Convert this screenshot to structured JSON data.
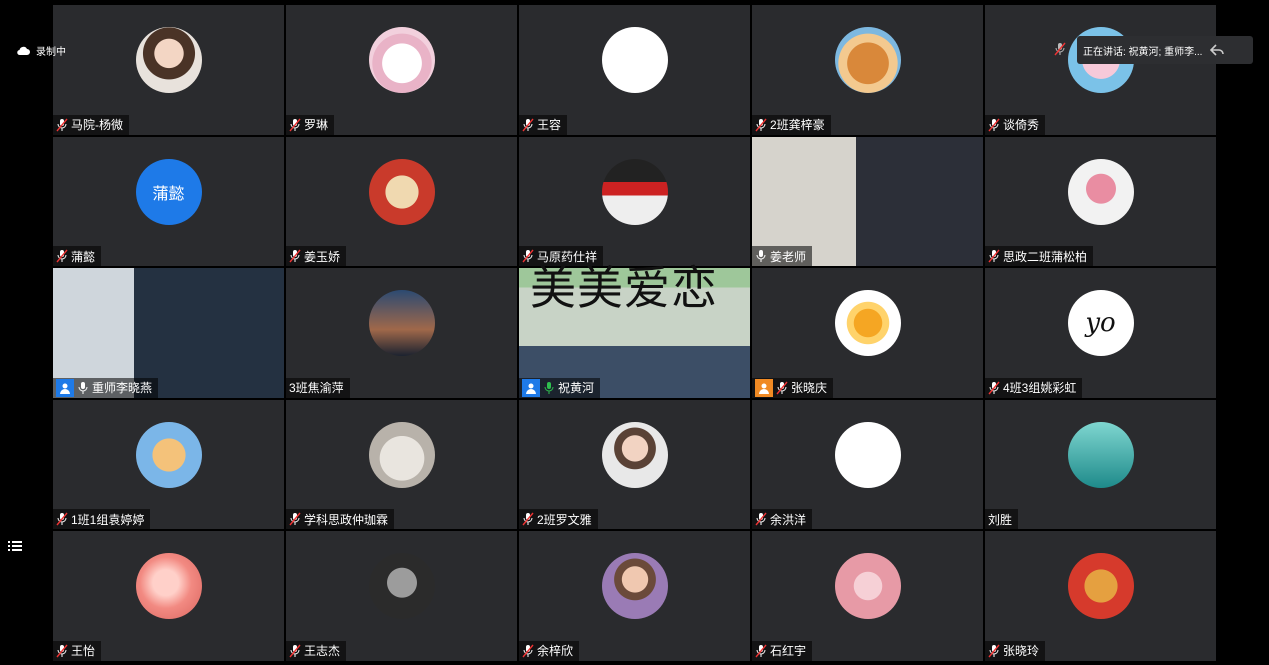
{
  "top_bar": {
    "recording_label": "录制中",
    "speaking_label": "正在讲话: 祝黄河; 重师李..."
  },
  "overlay_caption": "美美爱恋",
  "participants": [
    {
      "name": "马院-杨微",
      "avatar": "photo-woman",
      "mic": "muted"
    },
    {
      "name": "罗琳",
      "avatar": "cat",
      "mic": "muted"
    },
    {
      "name": "王容",
      "avatar": "cartoon-face",
      "mic": "muted"
    },
    {
      "name": "2班龚梓豪",
      "avatar": "shiba-dog",
      "mic": "muted"
    },
    {
      "name": "谈倚秀",
      "avatar": "pink-rabbit",
      "mic": "muted"
    },
    {
      "name": "蒲懿",
      "avatar": "text",
      "avatar_text": "蒲懿",
      "mic": "muted"
    },
    {
      "name": "姜玉娇",
      "avatar": "lucky-everyday",
      "mic": "muted"
    },
    {
      "name": "马原药仕祥",
      "avatar": "banner-photo",
      "mic": "muted"
    },
    {
      "name": "姜老师",
      "avatar": "video-man",
      "mic": "on"
    },
    {
      "name": "思政二班蒲松柏",
      "avatar": "astronaut",
      "mic": "muted"
    },
    {
      "name": "重师李晓燕",
      "avatar": "video-man-glasses",
      "mic": "on",
      "badge": "host"
    },
    {
      "name": "3班焦渝萍",
      "avatar": "city-night",
      "mic": "none"
    },
    {
      "name": "祝黄河",
      "avatar": "video-speaker",
      "mic": "speaking",
      "badge": "host",
      "active": true
    },
    {
      "name": "张晓庆",
      "avatar": "sun",
      "mic": "muted",
      "badge": "cohost"
    },
    {
      "name": "4班3组姚彩虹",
      "avatar": "yo-text",
      "avatar_text": "yo",
      "mic": "muted"
    },
    {
      "name": "1班1组袁婷婷",
      "avatar": "cartoon-kid",
      "mic": "muted"
    },
    {
      "name": "学科思政仲珈霖",
      "avatar": "seal",
      "mic": "muted"
    },
    {
      "name": "2班罗文雅",
      "avatar": "photo-dancer",
      "mic": "muted"
    },
    {
      "name": "余洪洋",
      "avatar": "text-card",
      "mic": "muted"
    },
    {
      "name": "刘胜",
      "avatar": "underwater",
      "mic": "none"
    },
    {
      "name": "王怡",
      "avatar": "peach",
      "mic": "muted"
    },
    {
      "name": "王志杰",
      "avatar": "bw-portrait",
      "mic": "muted"
    },
    {
      "name": "余梓欣",
      "avatar": "photo-girl",
      "mic": "muted"
    },
    {
      "name": "石红宇",
      "avatar": "blossom-girl",
      "mic": "muted"
    },
    {
      "name": "张晓玲",
      "avatar": "lucky-card",
      "mic": "muted"
    }
  ],
  "colors": {
    "tile": "#2a2b2e",
    "accent_blue": "#1e7ae8",
    "speaking_green": "#2fbf4f",
    "host_orange": "#f08a24"
  }
}
